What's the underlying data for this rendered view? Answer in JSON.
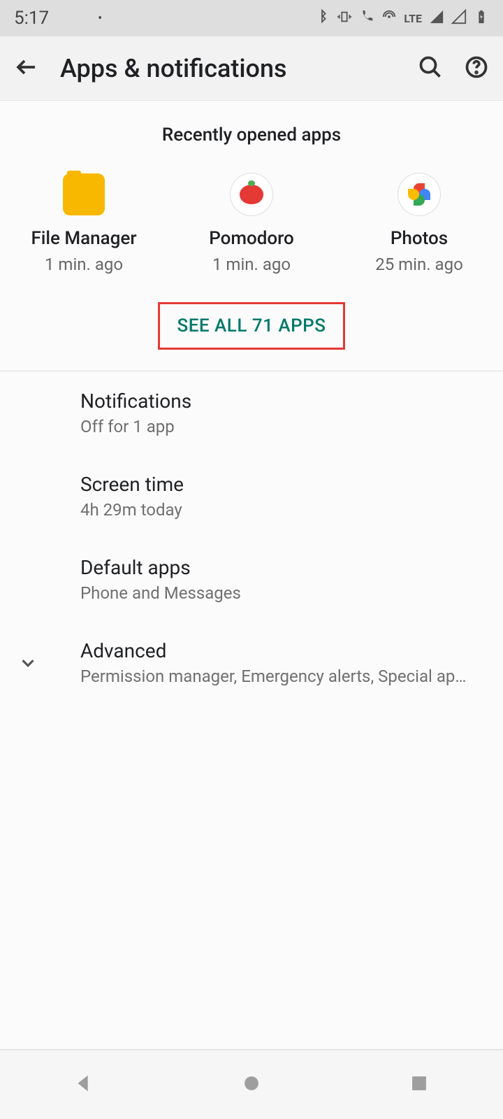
{
  "statusbar": {
    "time": "5:17",
    "lte": "LTE"
  },
  "toolbar": {
    "title": "Apps & notifications"
  },
  "recent": {
    "header": "Recently opened apps",
    "apps": [
      {
        "name": "File Manager",
        "time": "1 min. ago"
      },
      {
        "name": "Pomodoro",
        "time": "1 min. ago"
      },
      {
        "name": "Photos",
        "time": "25 min. ago"
      }
    ],
    "see_all": "SEE ALL 71 APPS"
  },
  "settings": [
    {
      "title": "Notifications",
      "sub": "Off for 1 app"
    },
    {
      "title": "Screen time",
      "sub": "4h 29m today"
    },
    {
      "title": "Default apps",
      "sub": "Phone and Messages"
    },
    {
      "title": "Advanced",
      "sub": "Permission manager, Emergency alerts, Special app a.."
    }
  ]
}
